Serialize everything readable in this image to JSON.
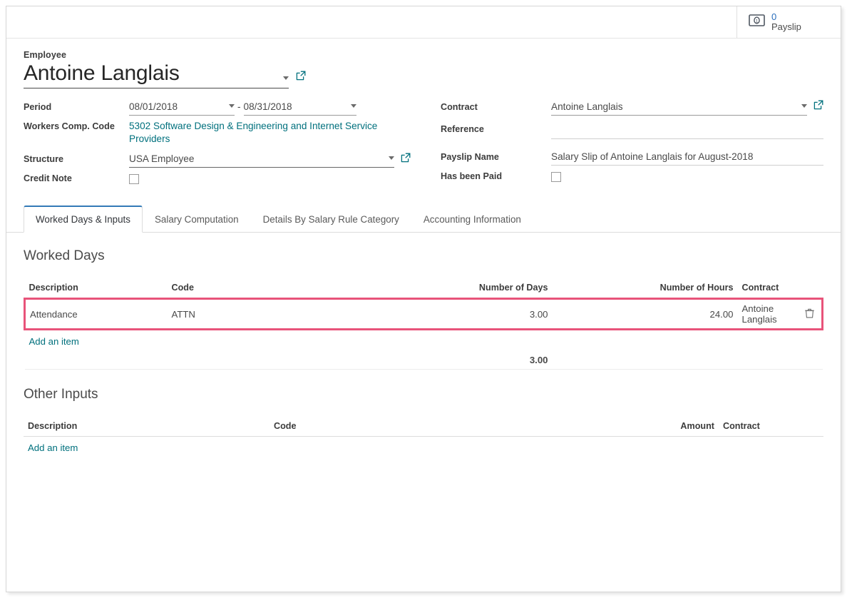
{
  "stat_button": {
    "icon": "money-bill-icon",
    "value": "0",
    "label": "Payslip"
  },
  "header": {
    "employee_label": "Employee",
    "employee_value": "Antoine Langlais"
  },
  "form": {
    "left": {
      "period_label": "Period",
      "period_from": "08/01/2018",
      "period_separator": "-",
      "period_to": "08/31/2018",
      "workers_comp_label": "Workers Comp. Code",
      "workers_comp_value": "5302 Software Design & Engineering and Internet Service Providers",
      "structure_label": "Structure",
      "structure_value": "USA Employee",
      "credit_note_label": "Credit Note",
      "credit_note_checked": false
    },
    "right": {
      "contract_label": "Contract",
      "contract_value": "Antoine Langlais",
      "reference_label": "Reference",
      "reference_value": "",
      "payslip_name_label": "Payslip Name",
      "payslip_name_value": "Salary Slip of Antoine Langlais for August-2018",
      "has_been_paid_label": "Has been Paid",
      "has_been_paid_checked": false
    }
  },
  "tabs": [
    {
      "label": "Worked Days & Inputs",
      "active": true
    },
    {
      "label": "Salary Computation",
      "active": false
    },
    {
      "label": "Details By Salary Rule Category",
      "active": false
    },
    {
      "label": "Accounting Information",
      "active": false
    }
  ],
  "worked_days": {
    "section_title": "Worked Days",
    "columns": [
      "Description",
      "Code",
      "Number of Days",
      "Number of Hours",
      "Contract"
    ],
    "rows": [
      {
        "description": "Attendance",
        "code": "ATTN",
        "number_of_days": "3.00",
        "number_of_hours": "24.00",
        "contract": "Antoine Langlais",
        "selected": true
      }
    ],
    "add_item_label": "Add an item",
    "total_days": "3.00"
  },
  "other_inputs": {
    "section_title": "Other Inputs",
    "columns": [
      "Description",
      "Code",
      "Amount",
      "Contract"
    ],
    "rows": [],
    "add_item_label": "Add an item"
  },
  "colors": {
    "link_teal": "#00707d",
    "stat_blue": "#2a6ebb",
    "selected_row": "#e8537a",
    "active_tab_border": "#337ab7"
  }
}
